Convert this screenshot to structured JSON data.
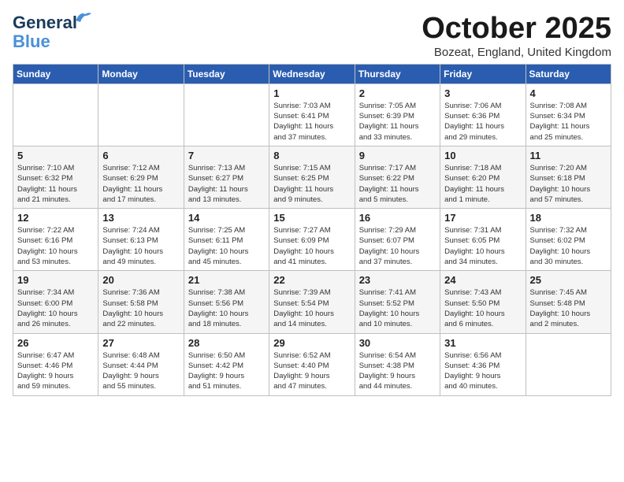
{
  "logo": {
    "line1": "General",
    "line2": "Blue"
  },
  "title": "October 2025",
  "location": "Bozeat, England, United Kingdom",
  "weekdays": [
    "Sunday",
    "Monday",
    "Tuesday",
    "Wednesday",
    "Thursday",
    "Friday",
    "Saturday"
  ],
  "weeks": [
    [
      {
        "day": "",
        "info": ""
      },
      {
        "day": "",
        "info": ""
      },
      {
        "day": "",
        "info": ""
      },
      {
        "day": "1",
        "info": "Sunrise: 7:03 AM\nSunset: 6:41 PM\nDaylight: 11 hours\nand 37 minutes."
      },
      {
        "day": "2",
        "info": "Sunrise: 7:05 AM\nSunset: 6:39 PM\nDaylight: 11 hours\nand 33 minutes."
      },
      {
        "day": "3",
        "info": "Sunrise: 7:06 AM\nSunset: 6:36 PM\nDaylight: 11 hours\nand 29 minutes."
      },
      {
        "day": "4",
        "info": "Sunrise: 7:08 AM\nSunset: 6:34 PM\nDaylight: 11 hours\nand 25 minutes."
      }
    ],
    [
      {
        "day": "5",
        "info": "Sunrise: 7:10 AM\nSunset: 6:32 PM\nDaylight: 11 hours\nand 21 minutes."
      },
      {
        "day": "6",
        "info": "Sunrise: 7:12 AM\nSunset: 6:29 PM\nDaylight: 11 hours\nand 17 minutes."
      },
      {
        "day": "7",
        "info": "Sunrise: 7:13 AM\nSunset: 6:27 PM\nDaylight: 11 hours\nand 13 minutes."
      },
      {
        "day": "8",
        "info": "Sunrise: 7:15 AM\nSunset: 6:25 PM\nDaylight: 11 hours\nand 9 minutes."
      },
      {
        "day": "9",
        "info": "Sunrise: 7:17 AM\nSunset: 6:22 PM\nDaylight: 11 hours\nand 5 minutes."
      },
      {
        "day": "10",
        "info": "Sunrise: 7:18 AM\nSunset: 6:20 PM\nDaylight: 11 hours\nand 1 minute."
      },
      {
        "day": "11",
        "info": "Sunrise: 7:20 AM\nSunset: 6:18 PM\nDaylight: 10 hours\nand 57 minutes."
      }
    ],
    [
      {
        "day": "12",
        "info": "Sunrise: 7:22 AM\nSunset: 6:16 PM\nDaylight: 10 hours\nand 53 minutes."
      },
      {
        "day": "13",
        "info": "Sunrise: 7:24 AM\nSunset: 6:13 PM\nDaylight: 10 hours\nand 49 minutes."
      },
      {
        "day": "14",
        "info": "Sunrise: 7:25 AM\nSunset: 6:11 PM\nDaylight: 10 hours\nand 45 minutes."
      },
      {
        "day": "15",
        "info": "Sunrise: 7:27 AM\nSunset: 6:09 PM\nDaylight: 10 hours\nand 41 minutes."
      },
      {
        "day": "16",
        "info": "Sunrise: 7:29 AM\nSunset: 6:07 PM\nDaylight: 10 hours\nand 37 minutes."
      },
      {
        "day": "17",
        "info": "Sunrise: 7:31 AM\nSunset: 6:05 PM\nDaylight: 10 hours\nand 34 minutes."
      },
      {
        "day": "18",
        "info": "Sunrise: 7:32 AM\nSunset: 6:02 PM\nDaylight: 10 hours\nand 30 minutes."
      }
    ],
    [
      {
        "day": "19",
        "info": "Sunrise: 7:34 AM\nSunset: 6:00 PM\nDaylight: 10 hours\nand 26 minutes."
      },
      {
        "day": "20",
        "info": "Sunrise: 7:36 AM\nSunset: 5:58 PM\nDaylight: 10 hours\nand 22 minutes."
      },
      {
        "day": "21",
        "info": "Sunrise: 7:38 AM\nSunset: 5:56 PM\nDaylight: 10 hours\nand 18 minutes."
      },
      {
        "day": "22",
        "info": "Sunrise: 7:39 AM\nSunset: 5:54 PM\nDaylight: 10 hours\nand 14 minutes."
      },
      {
        "day": "23",
        "info": "Sunrise: 7:41 AM\nSunset: 5:52 PM\nDaylight: 10 hours\nand 10 minutes."
      },
      {
        "day": "24",
        "info": "Sunrise: 7:43 AM\nSunset: 5:50 PM\nDaylight: 10 hours\nand 6 minutes."
      },
      {
        "day": "25",
        "info": "Sunrise: 7:45 AM\nSunset: 5:48 PM\nDaylight: 10 hours\nand 2 minutes."
      }
    ],
    [
      {
        "day": "26",
        "info": "Sunrise: 6:47 AM\nSunset: 4:46 PM\nDaylight: 9 hours\nand 59 minutes."
      },
      {
        "day": "27",
        "info": "Sunrise: 6:48 AM\nSunset: 4:44 PM\nDaylight: 9 hours\nand 55 minutes."
      },
      {
        "day": "28",
        "info": "Sunrise: 6:50 AM\nSunset: 4:42 PM\nDaylight: 9 hours\nand 51 minutes."
      },
      {
        "day": "29",
        "info": "Sunrise: 6:52 AM\nSunset: 4:40 PM\nDaylight: 9 hours\nand 47 minutes."
      },
      {
        "day": "30",
        "info": "Sunrise: 6:54 AM\nSunset: 4:38 PM\nDaylight: 9 hours\nand 44 minutes."
      },
      {
        "day": "31",
        "info": "Sunrise: 6:56 AM\nSunset: 4:36 PM\nDaylight: 9 hours\nand 40 minutes."
      },
      {
        "day": "",
        "info": ""
      }
    ]
  ]
}
